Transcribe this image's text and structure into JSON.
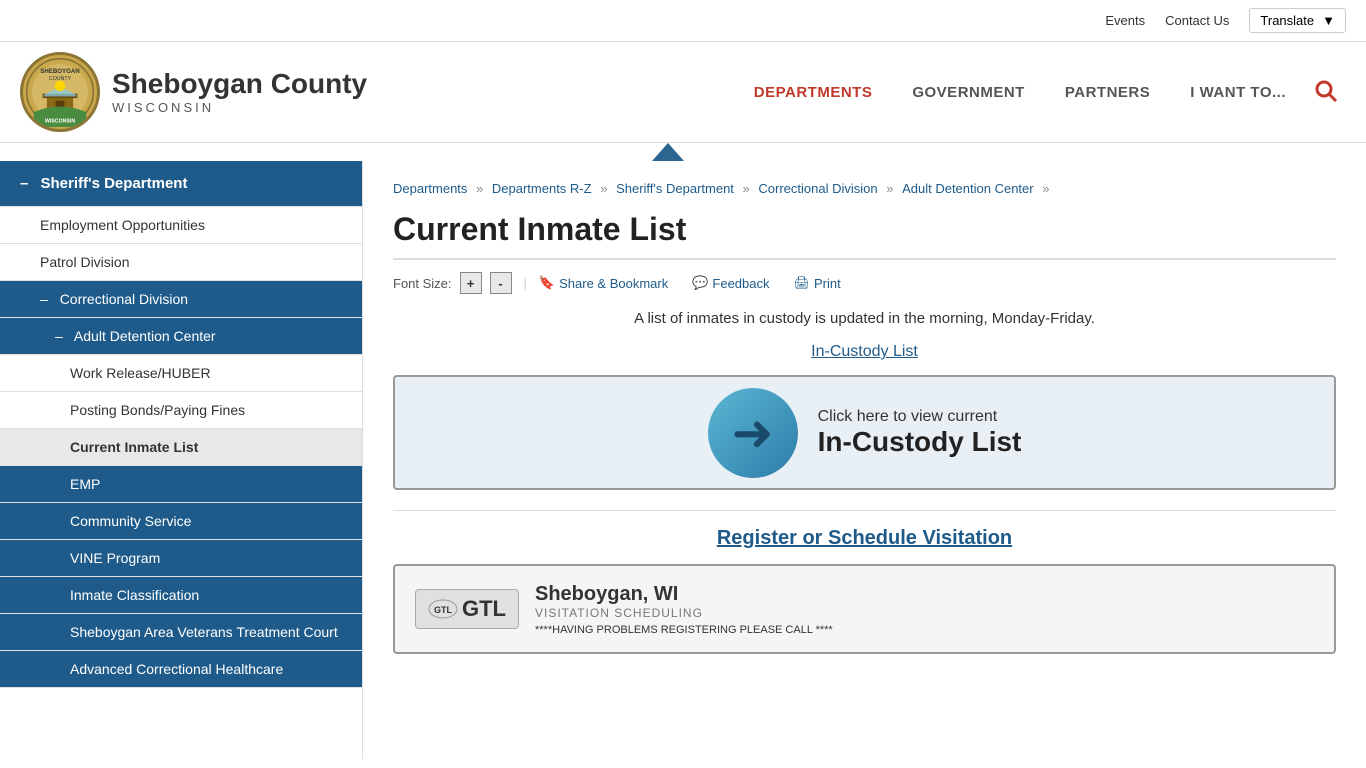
{
  "topbar": {
    "events_label": "Events",
    "contact_label": "Contact Us",
    "translate_label": "Translate"
  },
  "header": {
    "site_name": "Sheboygan County",
    "state": "WISCONSIN",
    "logo_alt": "Sheboygan County Logo"
  },
  "nav": {
    "items": [
      {
        "label": "DEPARTMENTS",
        "active": true
      },
      {
        "label": "GOVERNMENT",
        "active": false
      },
      {
        "label": "PARTNERS",
        "active": false
      },
      {
        "label": "I WANT TO...",
        "active": false
      }
    ]
  },
  "sidebar": {
    "items": [
      {
        "label": "Sheriff's Department",
        "level": 0,
        "active_section": true
      },
      {
        "label": "Employment Opportunities",
        "level": 1
      },
      {
        "label": "Patrol Division",
        "level": 1
      },
      {
        "label": "Correctional Division",
        "level": 1,
        "active_section": true
      },
      {
        "label": "Adult Detention Center",
        "level": 2
      },
      {
        "label": "Work Release/HUBER",
        "level": 3
      },
      {
        "label": "Posting Bonds/Paying Fines",
        "level": 3
      },
      {
        "label": "Current Inmate List",
        "level": 3,
        "active": true
      },
      {
        "label": "EMP",
        "level": 3
      },
      {
        "label": "Community Service",
        "level": 3
      },
      {
        "label": "VINE Program",
        "level": 3
      },
      {
        "label": "Inmate Classification",
        "level": 3
      },
      {
        "label": "Sheboygan Area Veterans Treatment Court",
        "level": 3
      },
      {
        "label": "Advanced Correctional Healthcare",
        "level": 3
      }
    ]
  },
  "breadcrumb": {
    "items": [
      {
        "label": "Departments",
        "href": "#"
      },
      {
        "label": "Departments R-Z",
        "href": "#"
      },
      {
        "label": "Sheriff's Department",
        "href": "#"
      },
      {
        "label": "Correctional Division",
        "href": "#"
      },
      {
        "label": "Adult Detention Center",
        "href": "#"
      }
    ]
  },
  "main": {
    "page_title": "Current Inmate List",
    "font_size_label": "Font Size:",
    "font_plus_label": "+",
    "font_minus_label": "-",
    "share_label": "Share & Bookmark",
    "feedback_label": "Feedback",
    "print_label": "Print",
    "description": "A list of inmates in custody is updated in the morning, Monday-Friday.",
    "custody_link_label": "In-Custody List",
    "banner_small_text": "Click here to view current",
    "banner_large_text": "In-Custody List",
    "visitation_link_label": "Register or Schedule Visitation",
    "gtl_logo_text": "GTL",
    "gtl_city": "Sheboygan, WI",
    "gtl_sub": "VISITATION SCHEDULING",
    "gtl_warning": "****HAVING PROBLEMS REGISTERING PLEASE CALL ****"
  }
}
